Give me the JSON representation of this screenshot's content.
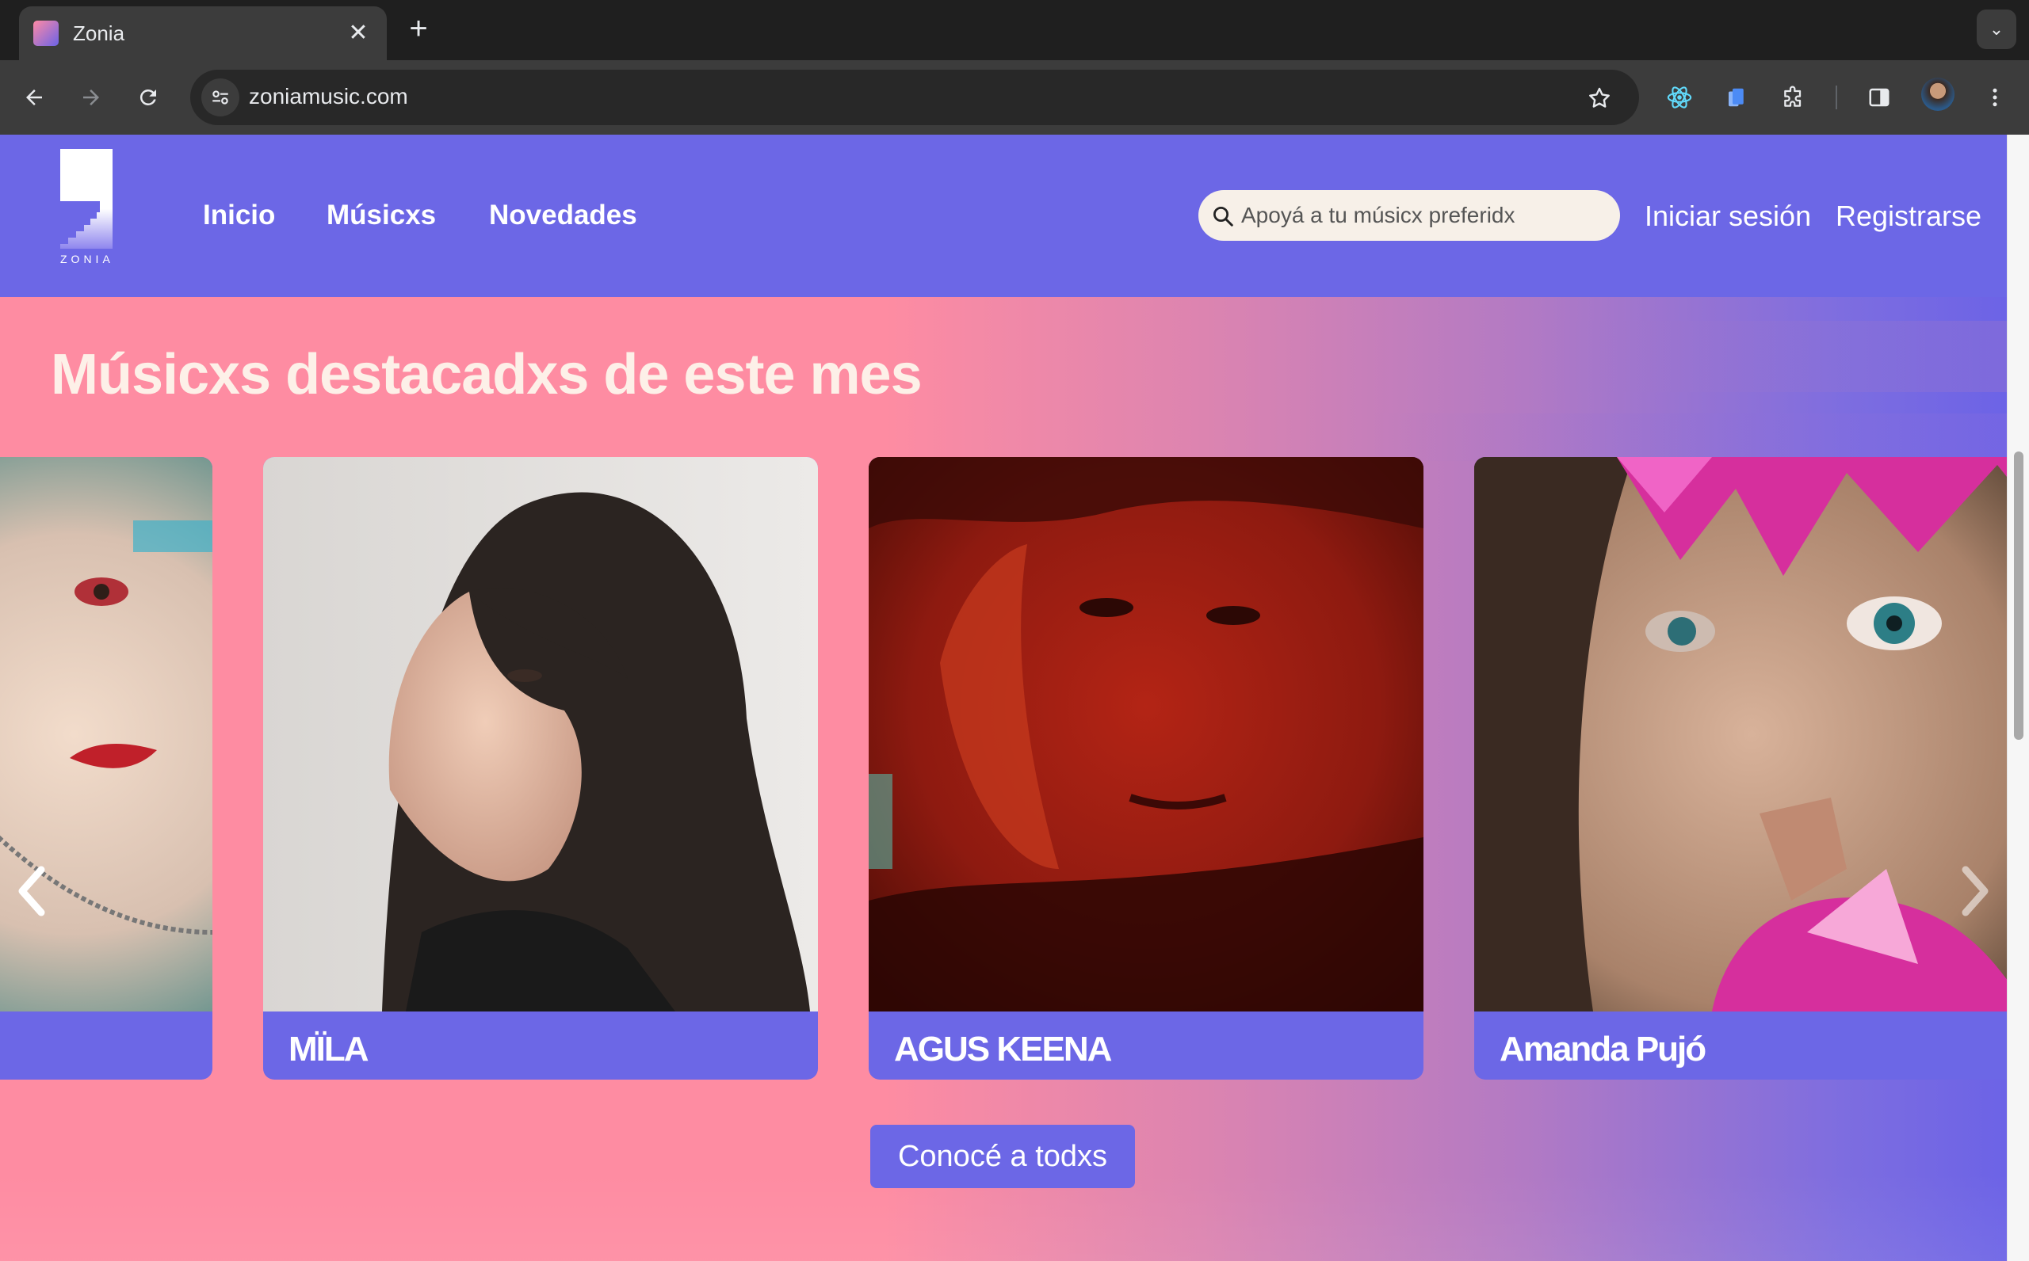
{
  "browser": {
    "tab": {
      "title": "Zonia",
      "close_glyph": "✕"
    },
    "new_tab_glyph": "+",
    "tab_menu_glyph": "⌄",
    "url": "zoniamusic.com",
    "icons": [
      "back-arrow-icon",
      "forward-arrow-icon",
      "reload-icon",
      "site-info-icon",
      "star-icon",
      "react-devtools-icon",
      "extension-doc-icon",
      "puzzle-icon",
      "side-panel-icon",
      "avatar",
      "more-vert-icon"
    ]
  },
  "site": {
    "logo_text": "ZONIA",
    "nav": [
      {
        "label": "Inicio"
      },
      {
        "label": "Músicxs"
      },
      {
        "label": "Novedades"
      }
    ],
    "search": {
      "placeholder": "Apoyá a tu músicx preferidx"
    },
    "login": "Iniciar sesión",
    "register": "Registrarse"
  },
  "featured": {
    "title": "Músicxs destacadxs de este mes",
    "artists": [
      {
        "name": ""
      },
      {
        "name": "MÏLA"
      },
      {
        "name": "AGUS KEENA"
      },
      {
        "name": "Amanda Pujó"
      }
    ],
    "cta": "Conocé a todxs"
  },
  "colors": {
    "header": "#6c67e6",
    "pink": "#fe8ca2",
    "violet": "#6c63e6",
    "title": "#fdf0e8"
  }
}
